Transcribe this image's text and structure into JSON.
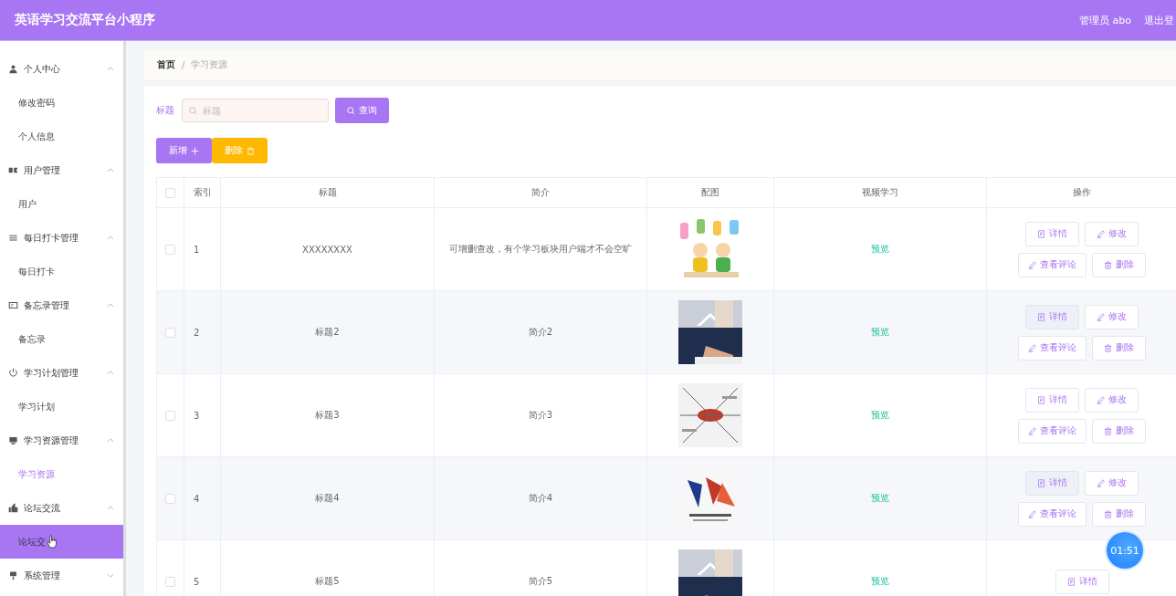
{
  "header": {
    "title": "英语学习交流平台小程序",
    "user": "管理员 abo",
    "logout": "退出登"
  },
  "sidebar": {
    "groups": [
      {
        "label": "个人中心",
        "expanded": true,
        "children": [
          {
            "label": "修改密码",
            "selected": false,
            "highlighted": false
          },
          {
            "label": "个人信息",
            "selected": false,
            "highlighted": false
          }
        ]
      },
      {
        "label": "用户管理",
        "expanded": true,
        "children": [
          {
            "label": "用户",
            "selected": false,
            "highlighted": false
          }
        ]
      },
      {
        "label": "每日打卡管理",
        "expanded": true,
        "children": [
          {
            "label": "每日打卡",
            "selected": false,
            "highlighted": false
          }
        ]
      },
      {
        "label": "备忘录管理",
        "expanded": true,
        "children": [
          {
            "label": "备忘录",
            "selected": false,
            "highlighted": false
          }
        ]
      },
      {
        "label": "学习计划管理",
        "expanded": true,
        "children": [
          {
            "label": "学习计划",
            "selected": false,
            "highlighted": false
          }
        ]
      },
      {
        "label": "学习资源管理",
        "expanded": true,
        "children": [
          {
            "label": "学习资源",
            "selected": true,
            "highlighted": false
          }
        ]
      },
      {
        "label": "论坛交流",
        "expanded": true,
        "children": [
          {
            "label": "论坛交",
            "selected": false,
            "highlighted": true
          }
        ]
      },
      {
        "label": "系统管理",
        "expanded": false
      }
    ]
  },
  "breadcrumb": {
    "separator": "/",
    "items": [
      "首页",
      "学习资源"
    ]
  },
  "search": {
    "label": "标题",
    "placeholder": "标题",
    "button": "查询"
  },
  "toolbar": {
    "add": "新增",
    "delete": "删除"
  },
  "table": {
    "select_all_checked": false,
    "columns": [
      "索引",
      "标题",
      "简介",
      "配图",
      "视频学习",
      "操作"
    ],
    "rows": [
      {
        "index": "1",
        "title": "XXXXXXXX",
        "intro": "可增删查改，有个学习板块用户端才不会空旷",
        "picture": {
          "kind": "picture"
        },
        "video": "预览",
        "checked": false,
        "actions": [
          {
            "kind": "detail",
            "label": "详情"
          },
          {
            "kind": "edit",
            "label": "修改"
          },
          {
            "kind": "comments",
            "label": "查看评论"
          },
          {
            "kind": "delete",
            "label": "删除"
          }
        ]
      },
      {
        "index": "2",
        "title": "标题2",
        "intro": "简介2",
        "picture": {
          "kind": "picture"
        },
        "video": "预览",
        "checked": false,
        "actions": [
          {
            "kind": "detail",
            "label": "详情"
          },
          {
            "kind": "edit",
            "label": "修改"
          },
          {
            "kind": "comments",
            "label": "查看评论"
          },
          {
            "kind": "delete",
            "label": "删除"
          }
        ]
      },
      {
        "index": "3",
        "title": "标题3",
        "intro": "简介3",
        "picture": {
          "kind": "picture"
        },
        "video": "预览",
        "checked": false,
        "actions": [
          {
            "kind": "detail",
            "label": "详情"
          },
          {
            "kind": "edit",
            "label": "修改"
          },
          {
            "kind": "comments",
            "label": "查看评论"
          },
          {
            "kind": "delete",
            "label": "删除"
          }
        ]
      },
      {
        "index": "4",
        "title": "标题4",
        "intro": "简介4",
        "picture": {
          "kind": "picture"
        },
        "video": "预览",
        "checked": false,
        "actions": [
          {
            "kind": "detail",
            "label": "详情"
          },
          {
            "kind": "edit",
            "label": "修改"
          },
          {
            "kind": "comments",
            "label": "查看评论"
          },
          {
            "kind": "delete",
            "label": "删除"
          }
        ]
      },
      {
        "index": "5",
        "title": "标题5",
        "intro": "简介5",
        "picture": {
          "kind": "picture"
        },
        "video": "预览",
        "checked": false,
        "actions": [
          {
            "kind": "detail",
            "label": "详情"
          }
        ]
      }
    ]
  },
  "timer": "01:51"
}
